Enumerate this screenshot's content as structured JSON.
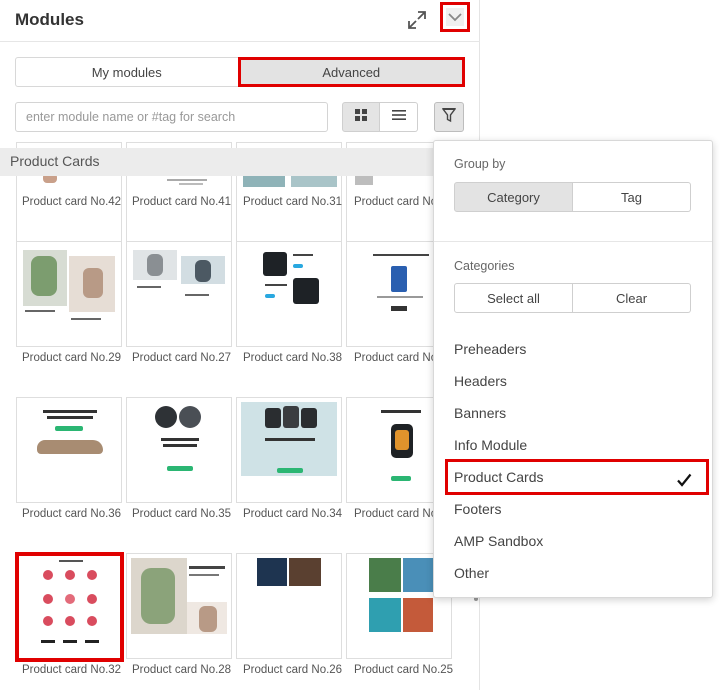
{
  "header": {
    "title": "Modules",
    "expand_icon": "expand-arrows-icon",
    "collapse_icon": "chevron-down-icon"
  },
  "tabs": [
    {
      "label": "My modules",
      "active": false
    },
    {
      "label": "Advanced",
      "active": true
    }
  ],
  "search": {
    "placeholder": "enter module name or #tag for search"
  },
  "view_toggle": {
    "grid_icon": "grid-icon",
    "list_icon": "list-icon",
    "filter_icon": "filter-funnel-icon"
  },
  "section": {
    "title": "Product Cards"
  },
  "cards": [
    {
      "label": "Product card No.42"
    },
    {
      "label": "Product card No.41"
    },
    {
      "label": "Product card No.31"
    },
    {
      "label": "Product card No"
    },
    {
      "label": "Product card No.29"
    },
    {
      "label": "Product card No.27"
    },
    {
      "label": "Product card No.38"
    },
    {
      "label": "Product card No"
    },
    {
      "label": "Product card No.36"
    },
    {
      "label": "Product card No.35"
    },
    {
      "label": "Product card No.34"
    },
    {
      "label": "Product card No"
    },
    {
      "label": "Product card No.32",
      "selected": true
    },
    {
      "label": "Product card No.28"
    },
    {
      "label": "Product card No.26"
    },
    {
      "label": "Product card No.25"
    }
  ],
  "dropdown": {
    "group_by_label": "Group by",
    "group_by_options": [
      "Category",
      "Tag"
    ],
    "group_by_selected": "Category",
    "categories_label": "Categories",
    "select_all": "Select all",
    "clear": "Clear",
    "categories": [
      {
        "name": "Preheaders",
        "checked": false
      },
      {
        "name": "Headers",
        "checked": false
      },
      {
        "name": "Banners",
        "checked": false
      },
      {
        "name": "Info Module",
        "checked": false
      },
      {
        "name": "Product Cards",
        "checked": true
      },
      {
        "name": "Footers",
        "checked": false
      },
      {
        "name": "AMP Sandbox",
        "checked": false
      },
      {
        "name": "Other",
        "checked": false
      }
    ]
  },
  "colors": {
    "highlight": "#e00000",
    "accent_green": "#2bb673",
    "accent_blue": "#29a8e0"
  }
}
